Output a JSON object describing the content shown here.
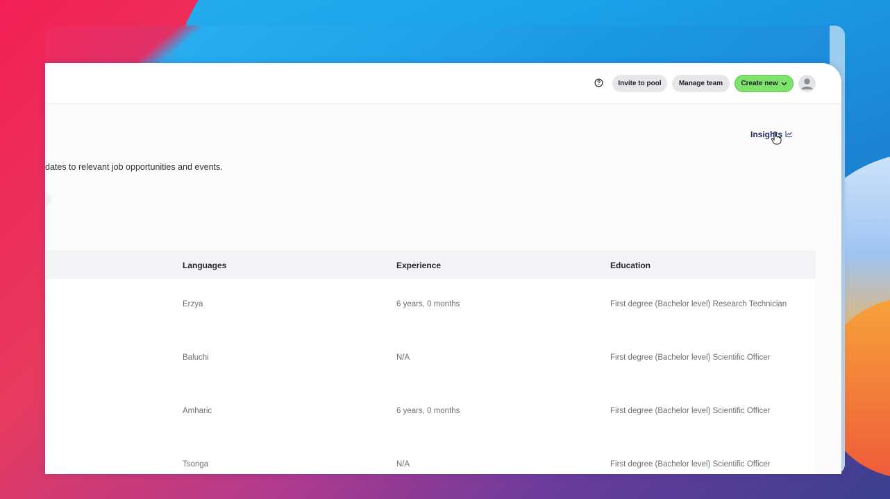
{
  "header": {
    "invite_label": "Invite to pool",
    "manage_label": "Manage team",
    "create_label": "Create new"
  },
  "insights": {
    "label": "Insights"
  },
  "description": "dates to relevant job opportunities and events.",
  "table": {
    "columns": [
      "Languages",
      "Experience",
      "Education"
    ],
    "rows": [
      {
        "language": "Erzya",
        "experience": "6 years, 0 months",
        "education": "First degree (Bachelor level) Research Technician"
      },
      {
        "language": "Baluchi",
        "experience": "N/A",
        "education": "First degree (Bachelor level) Scientific Officer"
      },
      {
        "language": "Amharic",
        "experience": "6 years, 0 months",
        "education": "First degree (Bachelor level) Scientific Officer"
      },
      {
        "language": "Tsonga",
        "experience": "N/A",
        "education": "First degree (Bachelor level) Scientific Officer"
      }
    ]
  },
  "colors": {
    "accent_green": "#7de36b",
    "link_navy": "#22306a",
    "pill_gray": "#e6e7ea"
  }
}
